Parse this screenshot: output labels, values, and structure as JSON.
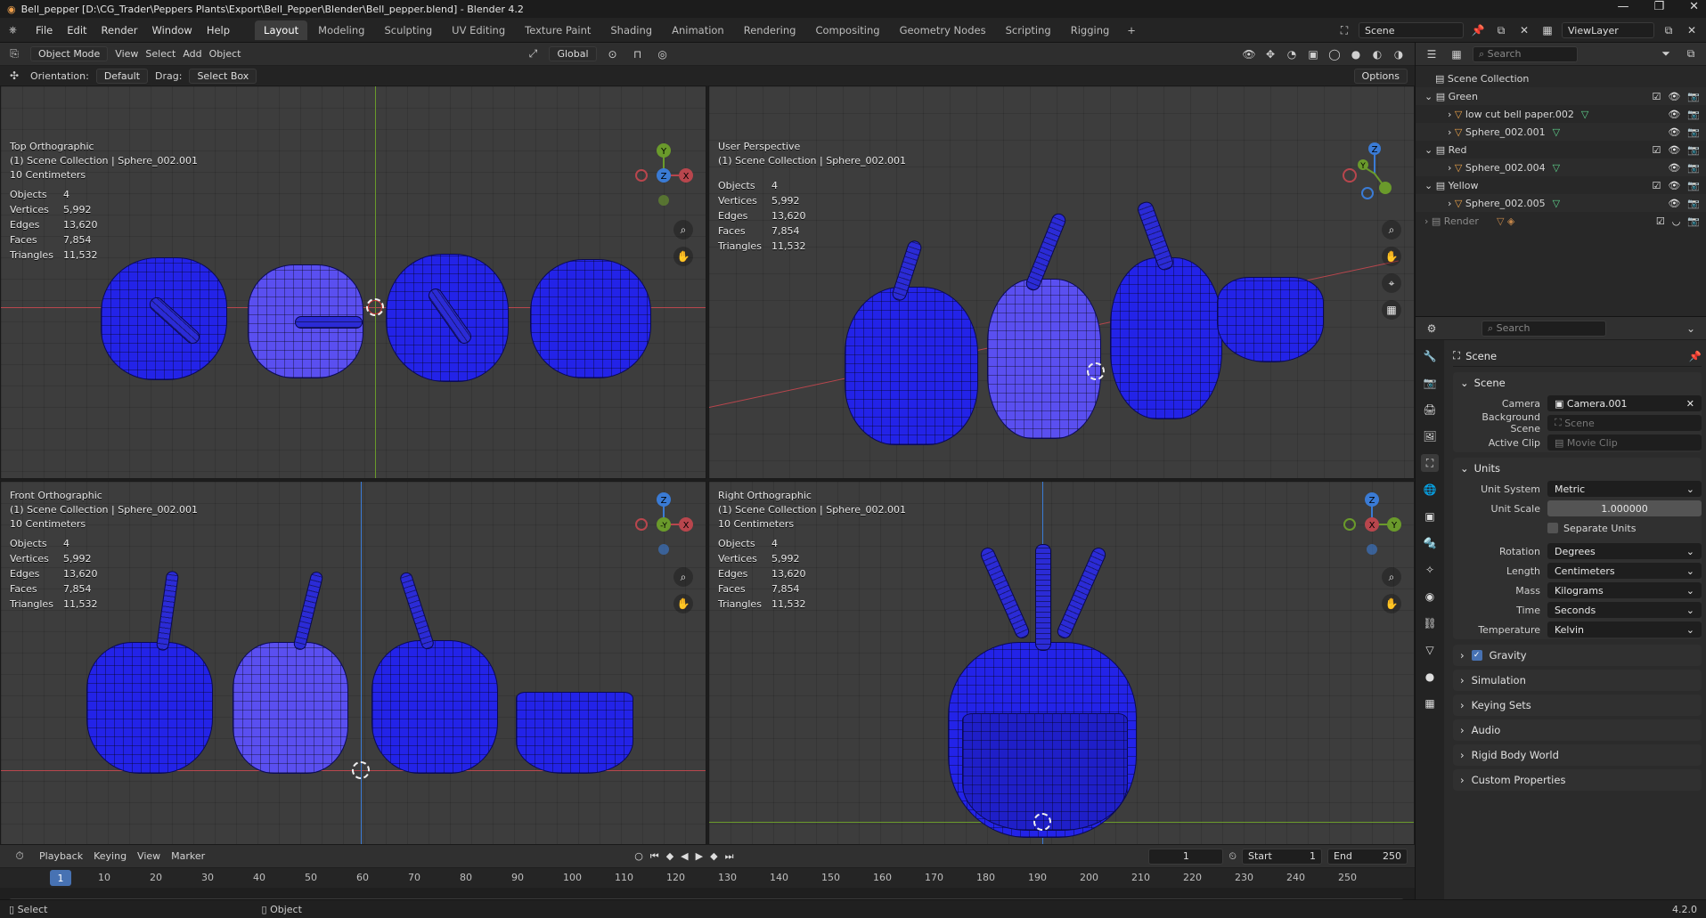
{
  "window": {
    "title": "Bell_pepper [D:\\CG_Trader\\Peppers Plants\\Export\\Bell_Pepper\\Blender\\Bell_pepper.blend] - Blender 4.2"
  },
  "menu": {
    "items": [
      "File",
      "Edit",
      "Render",
      "Window",
      "Help"
    ]
  },
  "workspaces": {
    "tabs": [
      "Layout",
      "Modeling",
      "Sculpting",
      "UV Editing",
      "Texture Paint",
      "Shading",
      "Animation",
      "Rendering",
      "Compositing",
      "Geometry Nodes",
      "Scripting",
      "Rigging"
    ],
    "active": "Layout",
    "add_label": "+"
  },
  "top_right": {
    "scene_label": "Scene",
    "viewlayer_label": "ViewLayer"
  },
  "viewport_header": {
    "mode": "Object Mode",
    "menus": [
      "View",
      "Select",
      "Add",
      "Object"
    ],
    "transform": "Global",
    "orientation_label": "Orientation:",
    "orientation_value": "Default",
    "drag_label": "Drag:",
    "drag_value": "Select Box",
    "options_label": "Options"
  },
  "viewports": [
    {
      "name": "Top Orthographic",
      "collection": "(1) Scene Collection | Sphere_002.001",
      "scale": "10 Centimeters"
    },
    {
      "name": "User Perspective",
      "collection": "(1) Scene Collection | Sphere_002.001",
      "scale": ""
    },
    {
      "name": "Front Orthographic",
      "collection": "(1) Scene Collection | Sphere_002.001",
      "scale": "10 Centimeters"
    },
    {
      "name": "Right Orthographic",
      "collection": "(1) Scene Collection | Sphere_002.001",
      "scale": "10 Centimeters"
    }
  ],
  "stats": {
    "objects_label": "Objects",
    "objects": "4",
    "vertices_label": "Vertices",
    "vertices": "5,992",
    "edges_label": "Edges",
    "edges": "13,620",
    "faces_label": "Faces",
    "faces": "7,854",
    "triangles_label": "Triangles",
    "triangles": "11,532"
  },
  "gizmo_labels": {
    "x": "X",
    "y": "Y",
    "z": "Z",
    "neg_y": "-Y"
  },
  "outliner": {
    "search_placeholder": "Search",
    "root": "Scene Collection",
    "rows": [
      {
        "label": "Green",
        "level": 1
      },
      {
        "label": "low cut bell paper.002",
        "level": 2
      },
      {
        "label": "Sphere_002.001",
        "level": 2
      },
      {
        "label": "Red",
        "level": 1
      },
      {
        "label": "Sphere_002.004",
        "level": 2
      },
      {
        "label": "Yellow",
        "level": 1
      },
      {
        "label": "Sphere_002.005",
        "level": 2
      },
      {
        "label": "Render",
        "level": 1
      }
    ]
  },
  "properties": {
    "search_placeholder": "Search",
    "context": "Scene",
    "scene_section": "Scene",
    "camera_label": "Camera",
    "camera_value": "Camera.001",
    "bg_scene_label": "Background Scene",
    "bg_scene_placeholder": "Scene",
    "active_clip_label": "Active Clip",
    "active_clip_placeholder": "Movie Clip",
    "units_section": "Units",
    "unit_system_label": "Unit System",
    "unit_system": "Metric",
    "unit_scale_label": "Unit Scale",
    "unit_scale": "1.000000",
    "separate_units": "Separate Units",
    "rotation_label": "Rotation",
    "rotation": "Degrees",
    "length_label": "Length",
    "length": "Centimeters",
    "mass_label": "Mass",
    "mass": "Kilograms",
    "time_label": "Time",
    "time": "Seconds",
    "temperature_label": "Temperature",
    "temperature": "Kelvin",
    "collapsed": [
      "Gravity",
      "Simulation",
      "Keying Sets",
      "Audio",
      "Rigid Body World",
      "Custom Properties"
    ]
  },
  "timeline": {
    "menus": [
      "Playback",
      "Keying",
      "View",
      "Marker"
    ],
    "current_frame": "1",
    "start_label": "Start",
    "start": "1",
    "end_label": "End",
    "end": "250",
    "ticks": [
      "1",
      "10",
      "20",
      "30",
      "40",
      "50",
      "60",
      "70",
      "80",
      "90",
      "100",
      "110",
      "120",
      "130",
      "140",
      "150",
      "160",
      "170",
      "180",
      "190",
      "200",
      "210",
      "220",
      "230",
      "240",
      "250"
    ]
  },
  "status": {
    "left": "Select",
    "middle": "Object",
    "version": "4.2.0"
  }
}
